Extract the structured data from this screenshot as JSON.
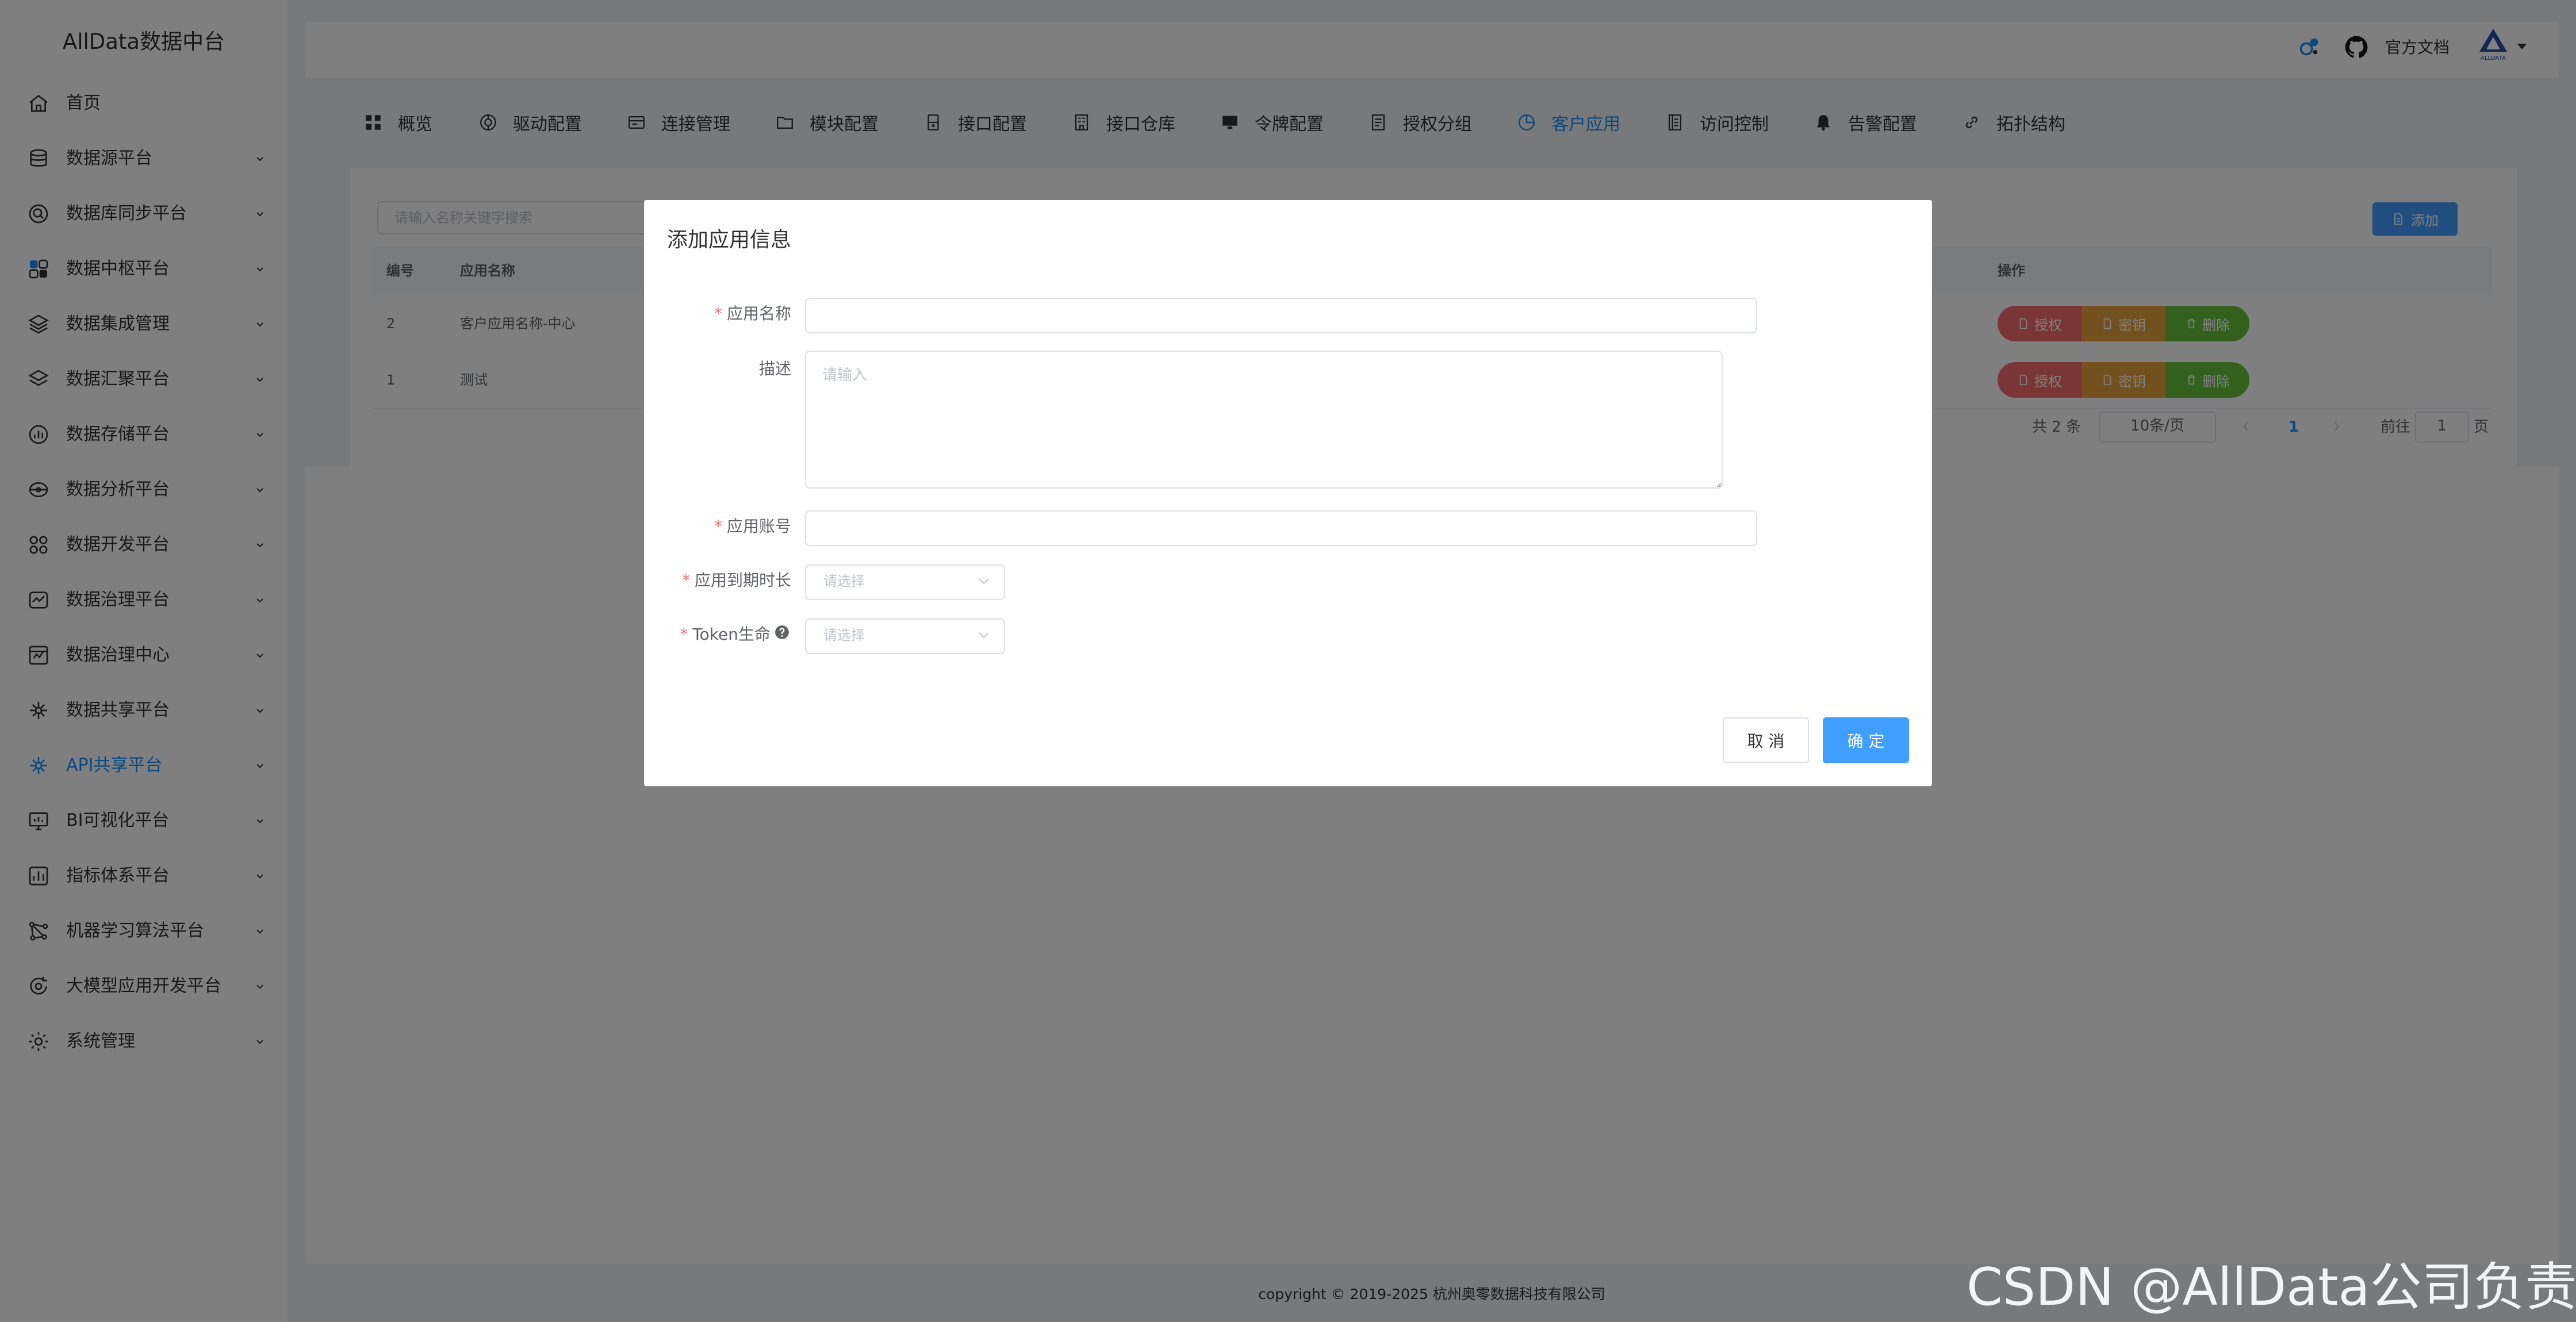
{
  "app": {
    "title": "AllData数据中台"
  },
  "sidebar": {
    "items": [
      {
        "label": "首页",
        "icon": "home-icon"
      },
      {
        "label": "数据源平台",
        "icon": "database-icon"
      },
      {
        "label": "数据库同步平台",
        "icon": "sync-search-icon"
      },
      {
        "label": "数据中枢平台",
        "icon": "hub-icon"
      },
      {
        "label": "数据集成管理",
        "icon": "layers-icon"
      },
      {
        "label": "数据汇聚平台",
        "icon": "stack-icon"
      },
      {
        "label": "数据存储平台",
        "icon": "storage-chart-icon"
      },
      {
        "label": "数据分析平台",
        "icon": "analysis-icon"
      },
      {
        "label": "数据开发平台",
        "icon": "grid-icon"
      },
      {
        "label": "数据治理平台",
        "icon": "governance-icon"
      },
      {
        "label": "数据治理中心",
        "icon": "governance-center-icon"
      },
      {
        "label": "数据共享平台",
        "icon": "share-icon"
      },
      {
        "label": "API共享平台",
        "icon": "api-share-icon"
      },
      {
        "label": "BI可视化平台",
        "icon": "monitor-icon"
      },
      {
        "label": "指标体系平台",
        "icon": "metrics-icon"
      },
      {
        "label": "机器学习算法平台",
        "icon": "ml-icon"
      },
      {
        "label": "大模型应用开发平台",
        "icon": "llm-icon"
      },
      {
        "label": "系统管理",
        "icon": "settings-icon"
      }
    ],
    "active_label": "API共享平台"
  },
  "header": {
    "docs_label": "官方文档",
    "icons": [
      "notification-icon",
      "github-icon",
      "alldata-logo-icon"
    ]
  },
  "tabs": [
    {
      "label": "概览",
      "icon": "grid-icon"
    },
    {
      "label": "驱动配置",
      "icon": "driver-icon"
    },
    {
      "label": "连接管理",
      "icon": "connection-icon"
    },
    {
      "label": "模块配置",
      "icon": "folder-icon"
    },
    {
      "label": "接口配置",
      "icon": "interface-icon"
    },
    {
      "label": "接口仓库",
      "icon": "warehouse-icon"
    },
    {
      "label": "令牌配置",
      "icon": "token-icon"
    },
    {
      "label": "授权分组",
      "icon": "auth-group-icon"
    },
    {
      "label": "客户应用",
      "icon": "client-app-icon"
    },
    {
      "label": "访问控制",
      "icon": "access-control-icon"
    },
    {
      "label": "告警配置",
      "icon": "bell-icon"
    },
    {
      "label": "拓扑结构",
      "icon": "link-icon"
    }
  ],
  "active_tab": "客户应用",
  "list": {
    "search_placeholder": "请输入名称关键字搜索",
    "add_label": "添加",
    "columns": [
      "编号",
      "应用名称",
      "操作"
    ],
    "rows": [
      {
        "id": "2",
        "name": "客户应用名称-中心"
      },
      {
        "id": "1",
        "name": "测试"
      }
    ],
    "actions": [
      "授权",
      "密钥",
      "删除"
    ],
    "pagination": {
      "total_text": "共 2 条",
      "page_size": "10条/页",
      "current_page": "1",
      "goto_prefix": "前往",
      "goto_value": "1",
      "goto_suffix": "页"
    }
  },
  "footer": {
    "copyright": "copyright © 2019-2025 杭州奥零数据科技有限公司"
  },
  "modal": {
    "title": "添加应用信息",
    "fields": {
      "name": {
        "label": "应用名称",
        "required": true,
        "value": ""
      },
      "description": {
        "label": "描述",
        "placeholder": "请输入",
        "value": ""
      },
      "account": {
        "label": "应用账号",
        "required": true,
        "value": ""
      },
      "expiry": {
        "label": "应用到期时长",
        "required": true,
        "placeholder": "请选择"
      },
      "token_life": {
        "label": "Token生命",
        "required": true,
        "placeholder": "请选择"
      }
    },
    "cancel_label": "取 消",
    "confirm_label": "确 定",
    "required_mark": "*"
  },
  "colors": {
    "primary": "#409eff",
    "danger": "#f56c6c",
    "warning": "#e6a23c",
    "success": "#67c23a",
    "active_nav": "#1890ff"
  },
  "watermark": "CSDN @AllData公司负责人"
}
